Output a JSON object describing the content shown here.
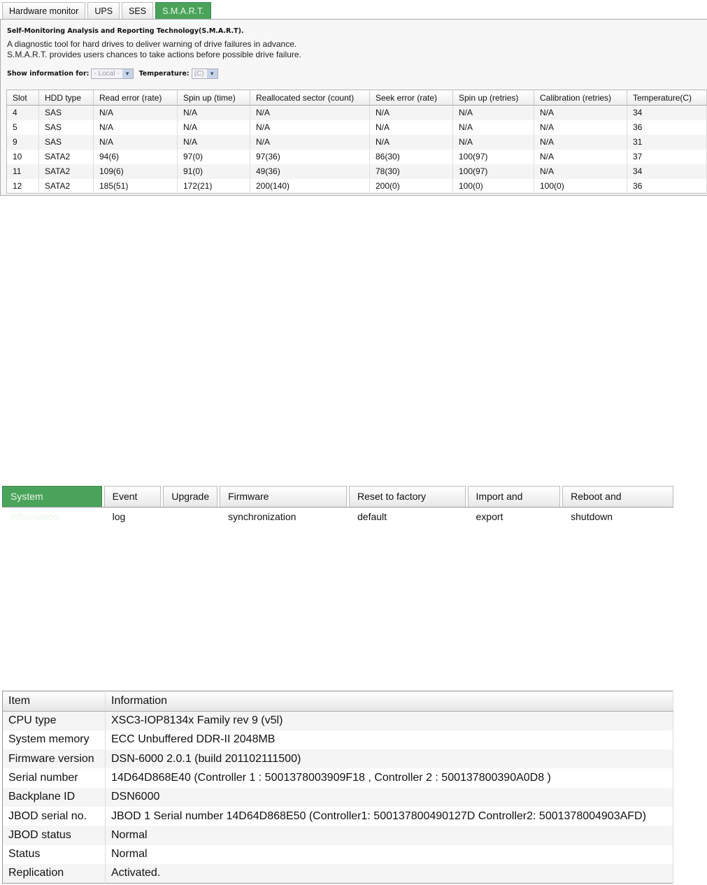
{
  "smart_tabs": [
    "Hardware monitor",
    "UPS",
    "SES",
    "S.M.A.R.T."
  ],
  "smart_active": 3,
  "smart": {
    "title": "Self-Monitoring Analysis and Reporting Technology(S.M.A.R.T).",
    "desc1": "A diagnostic tool for hard drives to deliver warning of drive failures in advance.",
    "desc2": "S.M.A.R.T. provides users chances to take actions before possible drive failure.",
    "show_label": "Show information for:",
    "show_value": "- Local -",
    "temp_label": "Temperature:",
    "temp_value": "(C)",
    "columns": [
      "Slot",
      "HDD type",
      "Read error (rate)",
      "Spin up (time)",
      "Reallocated sector (count)",
      "Seek error (rate)",
      "Spin up (retries)",
      "Calibration (retries)",
      "Temperature(C)"
    ],
    "rows": [
      [
        "4",
        "SAS",
        "N/A",
        "N/A",
        "N/A",
        "N/A",
        "N/A",
        "N/A",
        "34"
      ],
      [
        "5",
        "SAS",
        "N/A",
        "N/A",
        "N/A",
        "N/A",
        "N/A",
        "N/A",
        "36"
      ],
      [
        "9",
        "SAS",
        "N/A",
        "N/A",
        "N/A",
        "N/A",
        "N/A",
        "N/A",
        "31"
      ],
      [
        "10",
        "SATA2",
        "94(6)",
        "97(0)",
        "97(36)",
        "86(30)",
        "100(97)",
        "N/A",
        "37"
      ],
      [
        "11",
        "SATA2",
        "109(6)",
        "91(0)",
        "49(36)",
        "78(30)",
        "100(97)",
        "N/A",
        "34"
      ],
      [
        "12",
        "SATA2",
        "185(51)",
        "172(21)",
        "200(140)",
        "200(0)",
        "100(0)",
        "100(0)",
        "36"
      ]
    ]
  },
  "sys_tabs": [
    "System information",
    "Event log",
    "Upgrade",
    "Firmware synchronization",
    "Reset to factory default",
    "Import and export",
    "Reboot and shutdown"
  ],
  "sys_active": 0,
  "info": {
    "columns": [
      "Item",
      "Information"
    ],
    "rows": [
      [
        "CPU type",
        "XSC3-IOP8134x Family rev 9 (v5l)"
      ],
      [
        "System memory",
        "ECC Unbuffered DDR-II 2048MB"
      ],
      [
        "Firmware version",
        "DSN-6000 2.0.1 (build 201102111500)"
      ],
      [
        "Serial number",
        "14D64D868E40 (Controller 1 : 5001378003909F18 , Controller 2 : 500137800390A0D8 )"
      ],
      [
        "Backplane ID",
        "DSN6000"
      ],
      [
        "JBOD serial no.",
        "JBOD 1 Serial number 14D64D868E50 (Controller1: 500137800490127D Controller2: 5001378004903AFD)"
      ],
      [
        "JBOD status",
        "Normal"
      ],
      [
        "Status",
        "Normal"
      ],
      [
        "Replication",
        "Activated."
      ]
    ]
  }
}
